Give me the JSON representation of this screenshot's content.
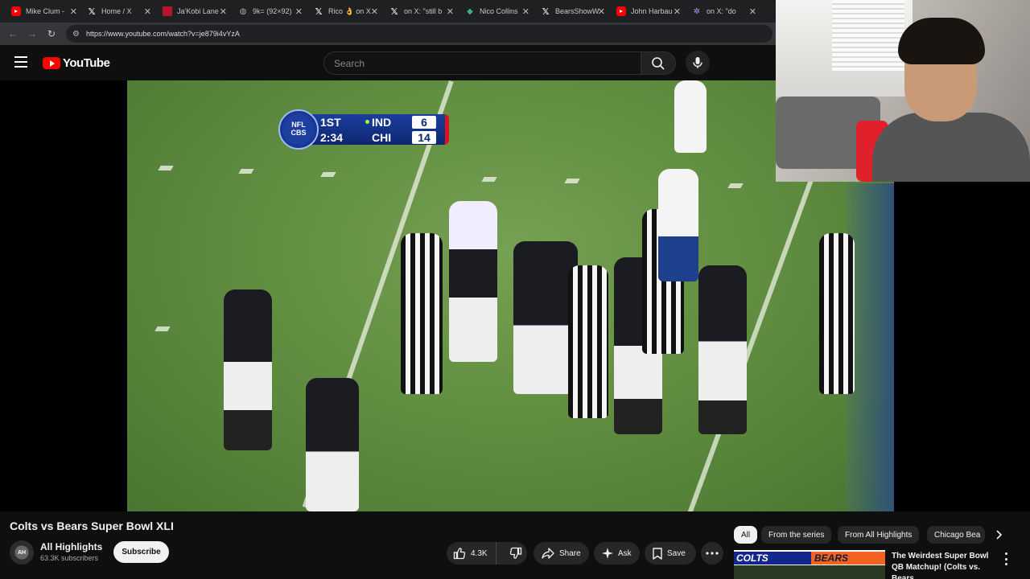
{
  "browser": {
    "tabs": [
      {
        "label": "Mike Clum -",
        "icon": "youtube-icon"
      },
      {
        "label": "Home / X",
        "icon": "x-icon"
      },
      {
        "label": "Ja'Kobi Lane",
        "icon": "usc-icon"
      },
      {
        "label": "9k= (92×92)",
        "icon": "globe-icon"
      },
      {
        "label": "Rico 👌 on X",
        "icon": "x-icon"
      },
      {
        "label": "on X: \"still b",
        "icon": "x-icon"
      },
      {
        "label": "Nico Collins",
        "icon": "nfl-icon"
      },
      {
        "label": "BearsShowW",
        "icon": "x-icon"
      },
      {
        "label": "John Harbau",
        "icon": "youtube-icon"
      },
      {
        "label": "on X: \"do",
        "icon": "bot-icon"
      }
    ],
    "url": "https://www.youtube.com/watch?v=je879i4vYzA"
  },
  "youtube": {
    "logo_text": "YouTube",
    "search_placeholder": "Search"
  },
  "scorebug": {
    "network_top": "NFL",
    "network_bottom": "CBS",
    "quarter": "1ST",
    "clock": "2:34",
    "team1": "IND",
    "score1": "6",
    "team2": "CHI",
    "score2": "14"
  },
  "video": {
    "title": "Colts vs Bears Super Bowl XLI",
    "channel_name": "All Highlights",
    "subscribers": "63.3K subscribers",
    "subscribe_label": "Subscribe",
    "likes": "4.3K",
    "share_label": "Share",
    "ask_label": "Ask",
    "save_label": "Save"
  },
  "chips": [
    {
      "label": "All",
      "active": true
    },
    {
      "label": "From the series",
      "active": false
    },
    {
      "label": "From All Highlights",
      "active": false
    },
    {
      "label": "Chicago Bea",
      "active": false
    }
  ],
  "recommendation": {
    "thumb_left": "COLTS",
    "thumb_right": "BEARS",
    "title": "The Weirdest Super Bowl QB Matchup! (Colts vs. Bears, ..."
  },
  "colors": {
    "background": "#0f0f0f",
    "youtube_red": "#ff0000",
    "chip_active": "#f1f1f1",
    "button_bg": "#272727"
  }
}
